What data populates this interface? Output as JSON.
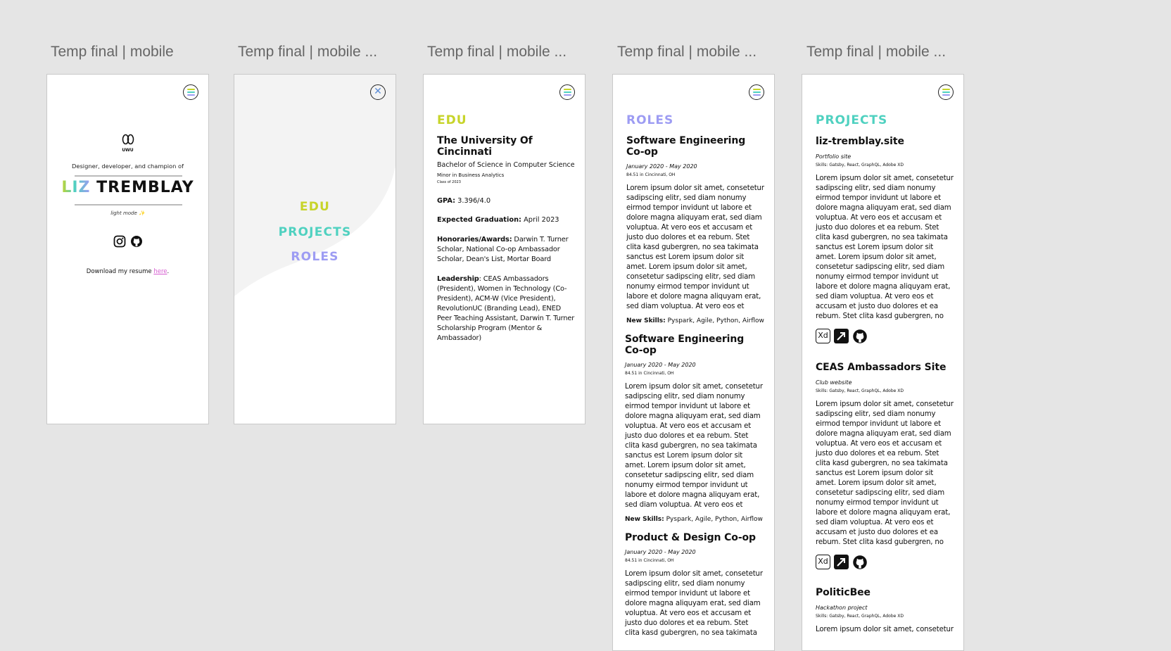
{
  "frames": [
    {
      "title": "Temp final | mobile"
    },
    {
      "title": "Temp final | mobile ..."
    },
    {
      "title": "Temp final | mobile ..."
    },
    {
      "title": "Temp final | mobile ..."
    },
    {
      "title": "Temp final | mobile ..."
    }
  ],
  "home": {
    "logo_text": "UWU",
    "tagline": "Designer, developer, and champion of",
    "name_first": "LIZ",
    "name_last": "TREMBLAY",
    "mode_label": "light mode ✨",
    "resume_prefix": "Download my resume ",
    "resume_link": "here",
    "resume_suffix": "."
  },
  "menu": {
    "items": [
      "EDU",
      "PROJECTS",
      "ROLES"
    ]
  },
  "edu": {
    "heading": "EDU",
    "school": "The University Of Cincinnati",
    "degree": "Bachelor of Science in Computer Science",
    "minor": "Minor in Business Analytics",
    "class_of": "Class of 2023",
    "gpa_label": "GPA:",
    "gpa_value": " 3.396/4.0",
    "grad_label": "Expected Graduation:",
    "grad_value": " April 2023",
    "honors_label": "Honoraries/Awards:",
    "honors_value": " Darwin T. Turner Scholar,  National Co-op Ambassador Scholar, Dean's List, Mortar Board",
    "leadership_label": "Leadership",
    "leadership_value": ": CEAS Ambassadors (President), Women in Technology (Co-President), ACM-W (Vice President), RevolutionUC (Branding Lead), ENED Peer Teaching Assistant, Darwin T. Turner Scholarship Program (Mentor & Ambassador)"
  },
  "roles": {
    "heading": "ROLES",
    "items": [
      {
        "title": "Software Engineering Co-op",
        "dates": "January 2020 - May 2020",
        "location": "84.51 in Cincinnati, OH",
        "body": "Lorem ipsum dolor sit amet, consetetur sadipscing elitr, sed diam nonumy eirmod tempor invidunt ut labore et dolore magna aliquyam erat, sed diam voluptua. At vero eos et accusam et justo duo dolores et ea rebum. Stet clita kasd gubergren, no sea takimata sanctus est Lorem ipsum dolor sit amet. Lorem ipsum dolor sit amet, consetetur sadipscing elitr, sed diam nonumy eirmod tempor invidunt ut labore et dolore magna aliquyam erat, sed diam voluptua. At vero eos et",
        "skills_label": "New Skills:",
        "skills": " Pyspark, Agile, Python, Airflow"
      },
      {
        "title": "Software Engineering Co-op",
        "dates": "January 2020 - May 2020",
        "location": "84.51 in Cincinnati, OH",
        "body": "Lorem ipsum dolor sit amet, consetetur sadipscing elitr, sed diam nonumy eirmod tempor invidunt ut labore et dolore magna aliquyam erat, sed diam voluptua. At vero eos et accusam et justo duo dolores et ea rebum. Stet clita kasd gubergren, no sea takimata sanctus est Lorem ipsum dolor sit amet. Lorem ipsum dolor sit amet, consetetur sadipscing elitr, sed diam nonumy eirmod tempor invidunt ut labore et dolore magna aliquyam erat, sed diam voluptua. At vero eos et",
        "skills_label": "New Skills:",
        "skills": " Pyspark, Agile, Python, Airflow"
      },
      {
        "title": "Product & Design Co-op",
        "dates": "January 2020 - May 2020",
        "location": "84.51 in Cincinnati, OH",
        "body": "Lorem ipsum dolor sit amet, consetetur sadipscing elitr, sed diam nonumy eirmod tempor invidunt ut labore et dolore magna aliquyam erat, sed diam voluptua. At vero eos et accusam et justo duo dolores et ea rebum. Stet clita kasd gubergren, no sea takimata"
      }
    ]
  },
  "projects": {
    "heading": "PROJECTS",
    "items": [
      {
        "title": "liz-tremblay.site",
        "subtitle": "Portfolio site",
        "skills": "Skills: Gatsby, React, GraphQL, Adobe XD",
        "body": "Lorem ipsum dolor sit amet, consetetur sadipscing elitr, sed diam nonumy eirmod tempor invidunt ut labore et dolore magna aliquyam erat, sed diam voluptua. At vero eos et accusam et justo duo dolores et ea rebum. Stet clita kasd gubergren, no sea takimata sanctus est Lorem ipsum dolor sit amet. Lorem ipsum dolor sit amet, consetetur sadipscing elitr, sed diam nonumy eirmod tempor invidunt ut labore et dolore magna aliquyam erat, sed diam voluptua. At vero eos et accusam et justo duo dolores et ea rebum. Stet clita kasd gubergren, no"
      },
      {
        "title": "CEAS Ambassadors Site",
        "subtitle": "Club website",
        "skills": "Skills: Gatsby, React, GraphQL, Adobe XD",
        "body": "Lorem ipsum dolor sit amet, consetetur sadipscing elitr, sed diam nonumy eirmod tempor invidunt ut labore et dolore magna aliquyam erat, sed diam voluptua. At vero eos et accusam et justo duo dolores et ea rebum. Stet clita kasd gubergren, no sea takimata sanctus est Lorem ipsum dolor sit amet. Lorem ipsum dolor sit amet, consetetur sadipscing elitr, sed diam nonumy eirmod tempor invidunt ut labore et dolore magna aliquyam erat, sed diam voluptua. At vero eos et accusam et justo duo dolores et ea rebum. Stet clita kasd gubergren, no"
      },
      {
        "title": "PoliticBee",
        "subtitle": "Hackathon project",
        "skills": "Skills: Gatsby, React, GraphQL, Adobe XD",
        "body": "Lorem ipsum dolor sit amet, consetetur"
      }
    ],
    "xd_label": "Xd"
  },
  "colors": {
    "lime": "#c7d42a",
    "teal": "#4fd1c0",
    "purple": "#9d9cf3",
    "pink": "#d65dd0",
    "canvas": "#e5e5e5"
  },
  "icons": [
    "hamburger-menu-icon",
    "close-icon",
    "instagram-icon",
    "github-icon",
    "adobe-xd-icon",
    "external-link-icon"
  ]
}
